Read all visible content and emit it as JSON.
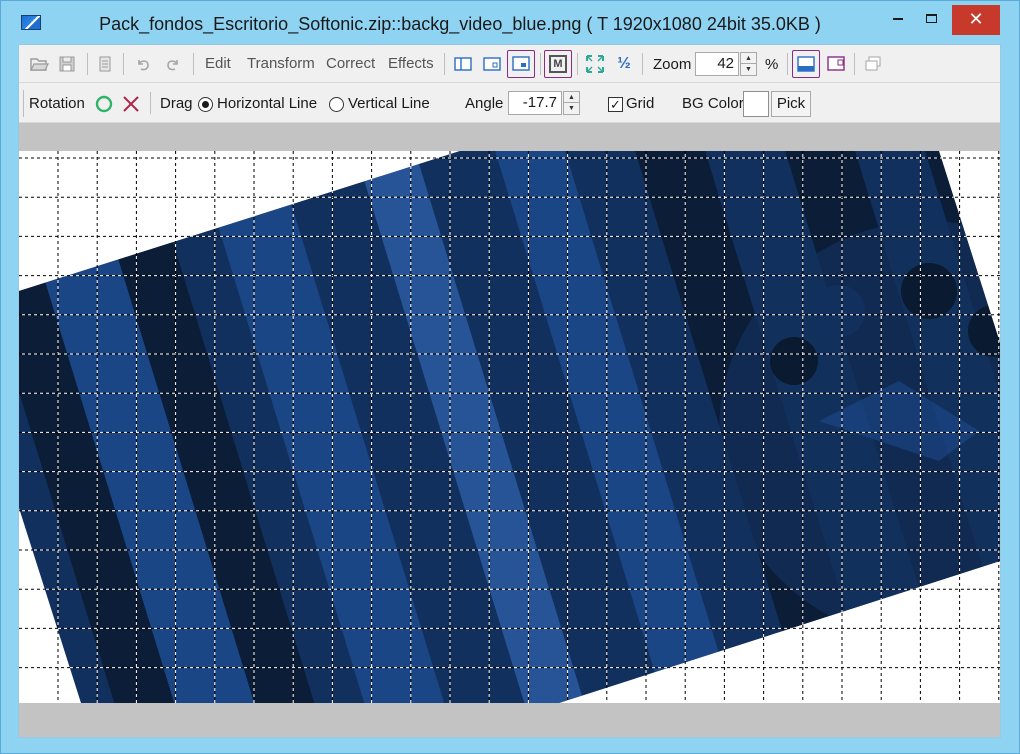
{
  "window": {
    "title": "Pack_fondos_Escritorio_Softonic.zip::backg_video_blue.png ( T  1920x1080  24bit  35.0KB )",
    "close_glyph": "✕"
  },
  "toolbar1": {
    "menus": [
      "Edit",
      "Transform",
      "Correct",
      "Effects"
    ],
    "zoom_label": "Zoom",
    "zoom_value": "42",
    "zoom_unit": "%",
    "fraction_glyph": "½",
    "m_glyph": "M"
  },
  "toolbar2": {
    "rotation_label": "Rotation",
    "drag_label": "Drag",
    "horizontal_line_label": "Horizontal Line",
    "vertical_line_label": "Vertical Line",
    "drag_mode_selected": "Horizontal Line",
    "angle_label": "Angle",
    "angle_value": "-17.7",
    "grid_label": "Grid",
    "grid_checked": true,
    "check_glyph": "✓",
    "bg_color_label": "BG Color",
    "bg_color_value": "#ffffff",
    "pick_label": "Pick"
  },
  "image": {
    "rotation_degrees": -17.7,
    "grid_visible": true,
    "colors": {
      "dark": "#0a1a30",
      "mid": "#12305d",
      "light": "#1d4a8c",
      "accent": "#2a5aa0"
    }
  },
  "accent_colors": {
    "title_bar": "#8fd3f3",
    "close_button": "#c7392a",
    "highlight_border": "#8a2b82",
    "icon_blue": "#2b6cc4",
    "icon_teal": "#2aa89a"
  }
}
